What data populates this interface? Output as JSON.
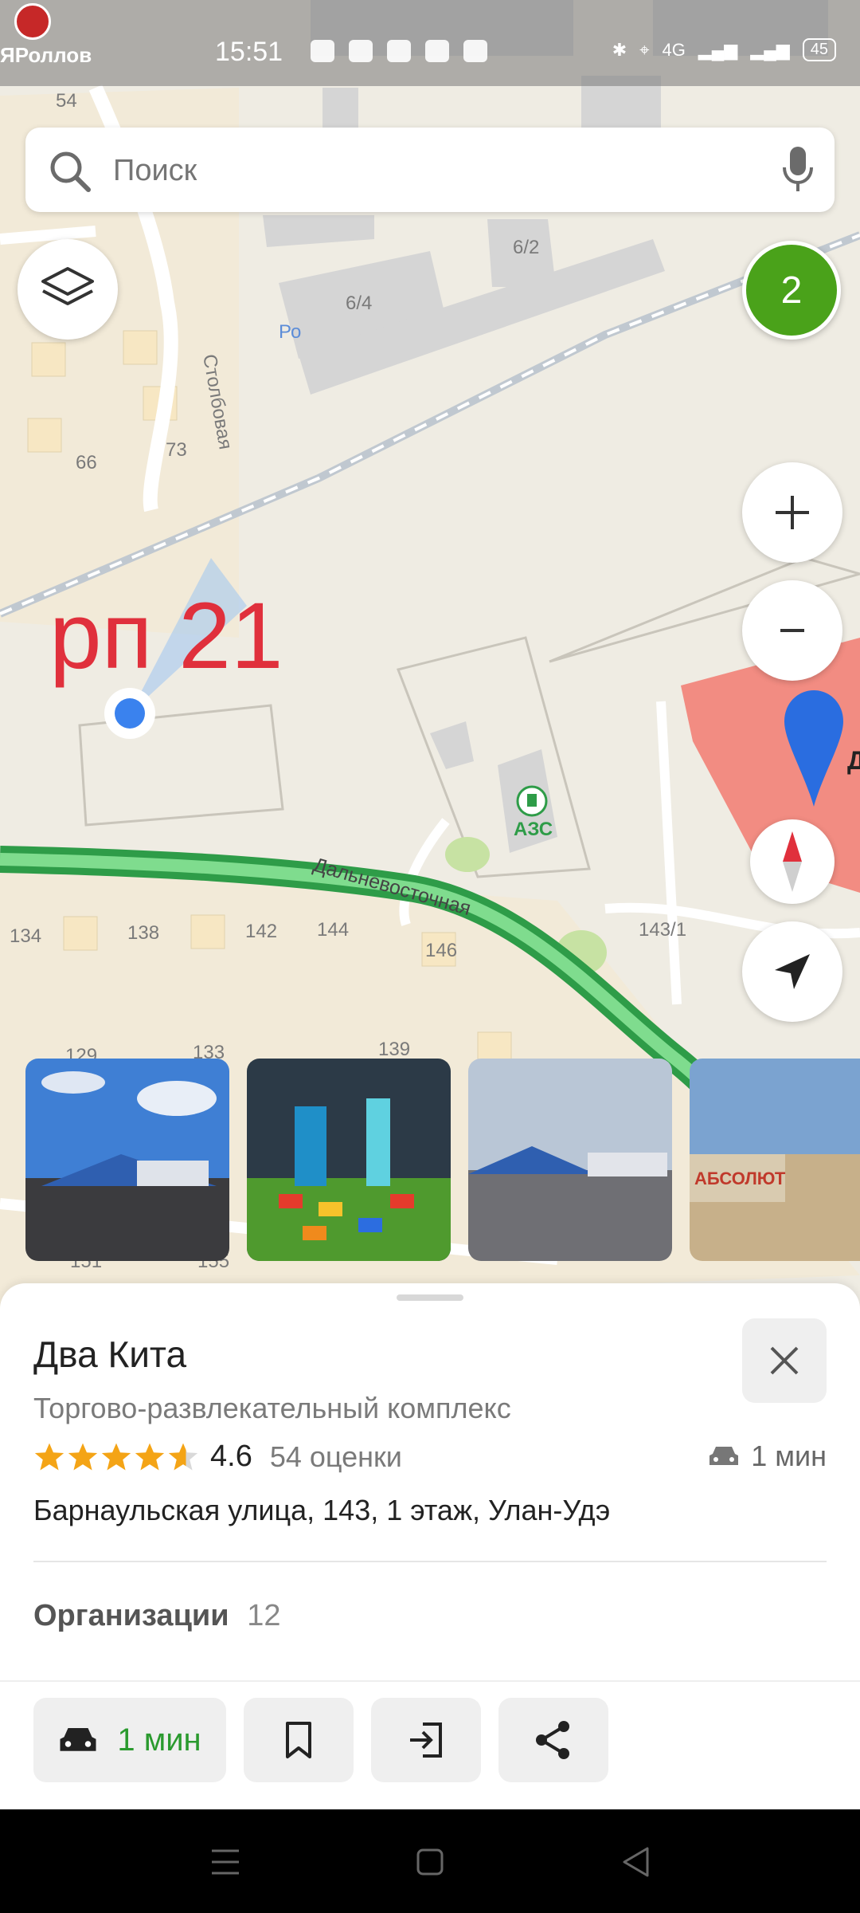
{
  "status_bar": {
    "app_label": "ЯРоллов",
    "time": "15:51",
    "network": "4G",
    "battery": "45"
  },
  "search": {
    "placeholder": "Поиск"
  },
  "map": {
    "cluster_count": "2",
    "overlay_label": "рп 21",
    "labels": {
      "house_54": "54",
      "house_6_2": "6/2",
      "house_6_4": "6/4",
      "street_stolbovaya": "Столбовая",
      "house_66": "66",
      "house_73": "73",
      "street_dalnevostochnaya": "Дальневосточная",
      "gas_station": "АЗС",
      "house_134": "134",
      "house_138": "138",
      "house_142": "142",
      "house_144": "144",
      "house_146": "146",
      "house_143_1": "143/1",
      "house_129": "129",
      "house_133": "133",
      "house_139": "139",
      "house_151": "151",
      "house_155": "155",
      "poi_fragment": "Д",
      "po_fragment": "Ро",
      "photo4_sign": "АБСОЛЮТ"
    }
  },
  "place": {
    "title": "Два Кита",
    "category": "Торгово-развлекательный комплекс",
    "rating_value": "4.6",
    "rating_stars": 4.6,
    "rating_count": "54 оценки",
    "travel_time": "1 мин",
    "address": "Барнаульская улица, 143, 1 этаж, Улан-Удэ",
    "organizations_label": "Организации",
    "organizations_count": "12"
  },
  "actions": {
    "route_time": "1 мин"
  },
  "colors": {
    "accent_green": "#2a9a2e",
    "cluster_green": "#4aa21a",
    "road_green": "#3fbf5a",
    "overlay_red": "#e0303c",
    "star_orange": "#f4a416",
    "mall_pink": "#f28c82"
  }
}
